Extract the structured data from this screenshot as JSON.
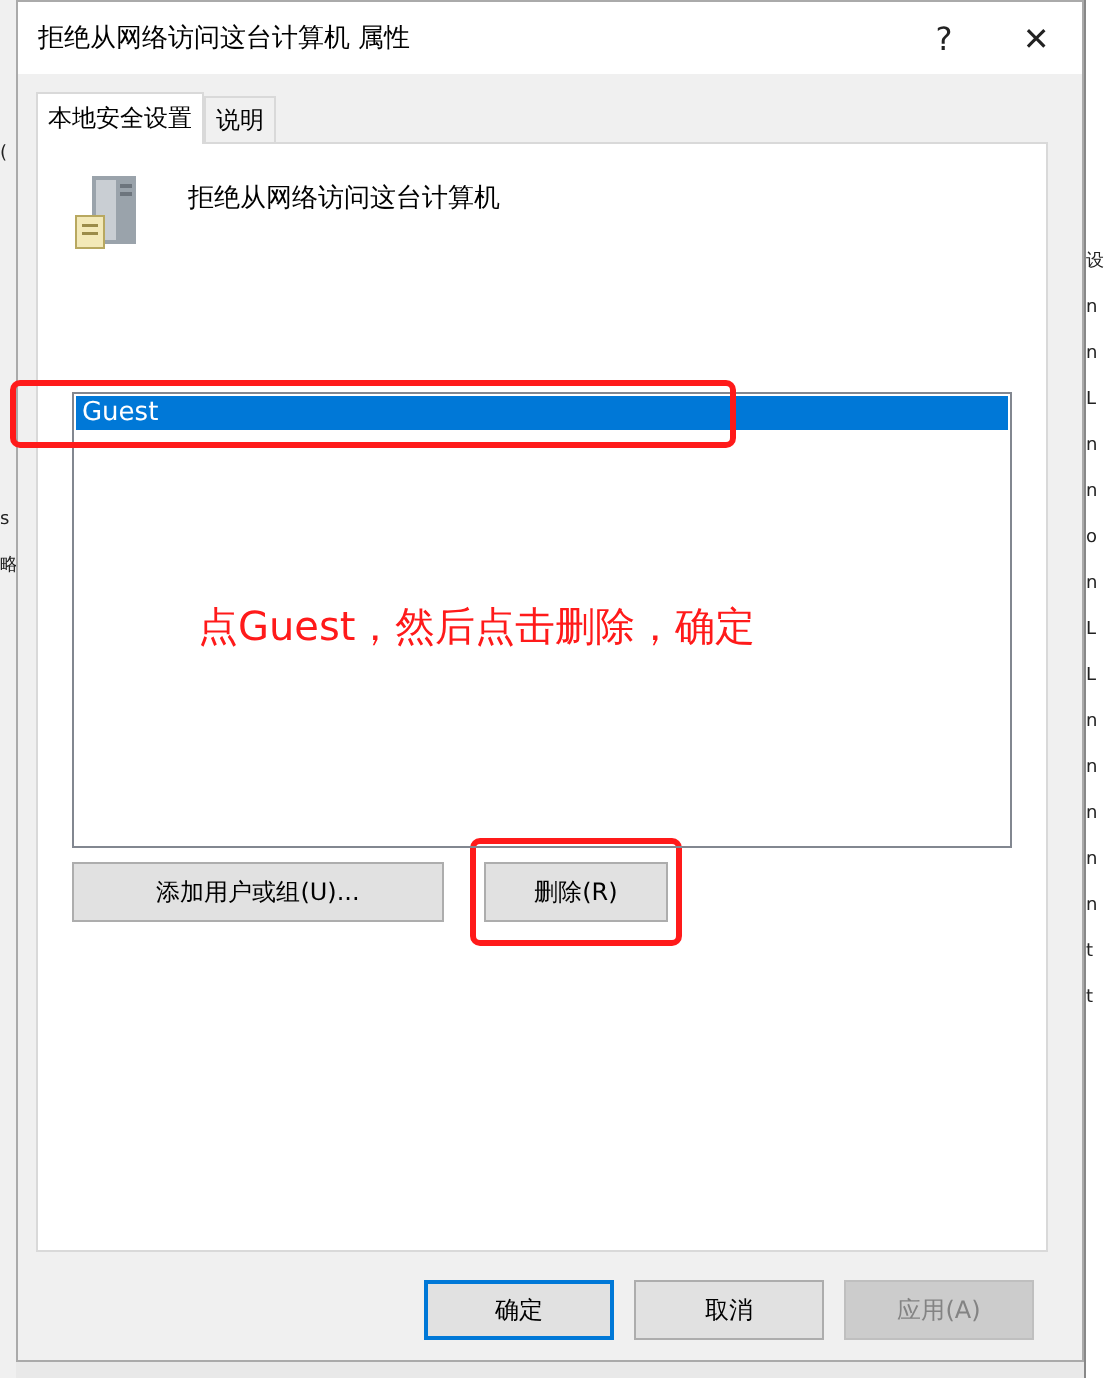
{
  "background_window": {
    "left_fragments": [
      "(",
      "s",
      "略"
    ],
    "right_fragments": [
      "设",
      "n",
      "n",
      "L",
      "n",
      "n",
      "o",
      "n",
      "L",
      "L",
      "n",
      "n",
      "n",
      "n",
      "n",
      "t",
      "t"
    ]
  },
  "window": {
    "title": "拒绝从网络访问这台计算机 属性",
    "help": "?",
    "close": "✕"
  },
  "tabs": [
    {
      "label": "本地安全设置",
      "selected": true
    },
    {
      "label": "说明",
      "selected": false
    }
  ],
  "policy": {
    "name": "拒绝从网络访问这台计算机"
  },
  "members": [
    {
      "name": "Guest",
      "selected": true
    }
  ],
  "list_buttons": [
    {
      "label": "添加用户或组(U)...",
      "highlighted": false
    },
    {
      "label": "删除(R)",
      "highlighted": true
    }
  ],
  "annotation": {
    "note": "点Guest，然后点击删除，确定"
  },
  "footer_buttons": [
    {
      "label": "确定",
      "default": true,
      "disabled": false
    },
    {
      "label": "取消",
      "default": false,
      "disabled": false
    },
    {
      "label": "应用(A)",
      "default": false,
      "disabled": true
    }
  ]
}
